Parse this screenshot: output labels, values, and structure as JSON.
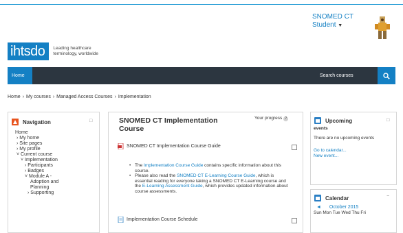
{
  "header": {
    "logo": "ihtsdo",
    "tagline": "Leading healthcare terminology, worldwide",
    "user_line1": "SNOMED CT",
    "user_line2": "Student",
    "caret": "▼"
  },
  "navbar": {
    "home": "Home",
    "search_label": "Search courses"
  },
  "breadcrumb": [
    "Home",
    "My courses",
    "Managed Access Courses",
    "Implementation"
  ],
  "breadcrumb_sep": "›",
  "navigation": {
    "title": "Navigation",
    "collapse": "□",
    "items": [
      "Home",
      "› My home",
      "› Site pages",
      "› My profile",
      "˅ Current course",
      "˅ Implementation",
      "› Participants",
      "› Badges",
      "˅ Module A -",
      "Adoption and",
      "Planning",
      "› Supporting"
    ]
  },
  "main": {
    "title": "SNOMED CT Implementation Course",
    "progress_label": "Your progress",
    "progress_icon": "?",
    "activity1": "SNOMED CT Implementation Course Guide",
    "bullet1_a": "The ",
    "bullet1_link": "Implementation Course Guide",
    "bullet1_b": " contains specific information about this course.",
    "bullet2_a": "Please also read the ",
    "bullet2_link1": "SNOMED CT E-Learning Course Guide",
    "bullet2_b": ", which is essential reading for everyone taking a SNOMED CT E-Learning course and the ",
    "bullet2_link2": "E-Learning Assessment Guide",
    "bullet2_c": ", which provides updated information about course assessments.",
    "activity2": "Implementation Course Schedule"
  },
  "upcoming": {
    "title": "Upcoming",
    "title2": "events",
    "text": "There are no upcoming events",
    "link1": "Go to calendar...",
    "link2": "New event...",
    "collapse": "□"
  },
  "calendar": {
    "title": "Calendar",
    "prev": "◄",
    "month": "October 2015",
    "days": "Sun Mon Tue Wed Thu Fri",
    "collapse": "−"
  },
  "colors": {
    "brand_blue": "#1480c4",
    "navbar_dark": "#2c3640",
    "nav_icon_orange": "#e8541e"
  }
}
